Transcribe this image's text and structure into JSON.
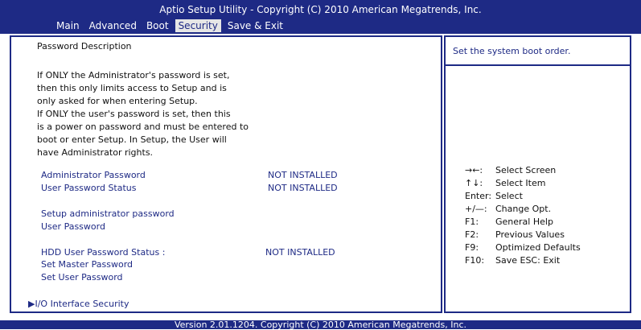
{
  "header": {
    "title": "Aptio Setup Utility - Copyright (C) 2010 American Megatrends, Inc.",
    "tabs": [
      "Main",
      "Advanced",
      "Boot",
      "Security",
      "Save & Exit"
    ],
    "active_tab": "Security"
  },
  "main": {
    "section_title": "Password Description",
    "description_lines": [
      "If ONLY the Administrator's password is set,",
      "then this only limits access to Setup and is",
      "only asked for when entering Setup.",
      "If ONLY the user's password is set, then this",
      "is a power on password and must be entered to",
      "boot or enter Setup. In Setup, the User will",
      "have Administrator rights."
    ],
    "admin_password_label": "Administrator Password",
    "admin_password_value": "NOT INSTALLED",
    "user_password_status_label": "User Password Status",
    "user_password_status_value": "NOT INSTALLED",
    "setup_admin_password_label": "Setup administrator password",
    "user_password_label": "User Password",
    "hdd_user_password_status_label": "HDD User Password Status  :",
    "hdd_user_password_status_value": "NOT INSTALLED",
    "set_master_password_label": "Set Master Password",
    "set_user_password_label": "Set User Password",
    "io_interface_security_label": "I/O Interface Security"
  },
  "help": {
    "hint": "Set the system boot order.",
    "keys": [
      {
        "key": "→←:",
        "action": "Select Screen"
      },
      {
        "key": "↑↓:",
        "action": "Select Item"
      },
      {
        "key": "Enter:",
        "action": "Select"
      },
      {
        "key": "+/—:",
        "action": "Change Opt."
      },
      {
        "key": "F1:",
        "action": "General Help"
      },
      {
        "key": "F2:",
        "action": "Previous Values"
      },
      {
        "key": "F9:",
        "action": "Optimized Defaults"
      },
      {
        "key": "F10:",
        "action": "Save   ESC: Exit"
      }
    ]
  },
  "footer": {
    "version": "Version 2.01.1204. Copyright (C) 2010 American Megatrends, Inc."
  },
  "colors": {
    "bios_blue": "#1e2a85",
    "panel_background": "#ffffff",
    "active_tab_background": "#e6e6e6"
  }
}
